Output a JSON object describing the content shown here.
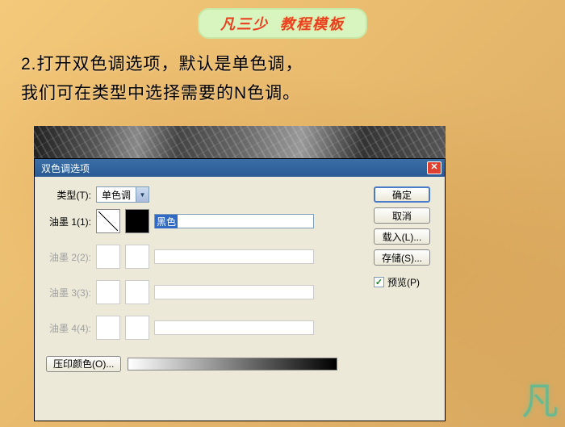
{
  "banner": {
    "part1": "凡三少",
    "part2": "教程模板"
  },
  "instruction": {
    "line1": "2.打开双色调选项，默认是单色调，",
    "line2": "我们可在类型中选择需要的N色调。"
  },
  "dialog": {
    "title": "双色调选项",
    "type_label": "类型(T):",
    "type_value": "单色调",
    "inks": [
      {
        "label": "油墨 1(1):",
        "name": "黑色",
        "enabled": true
      },
      {
        "label": "油墨 2(2):",
        "name": "",
        "enabled": false
      },
      {
        "label": "油墨 3(3):",
        "name": "",
        "enabled": false
      },
      {
        "label": "油墨 4(4):",
        "name": "",
        "enabled": false
      }
    ],
    "overprint_label": "压印颜色(O)...",
    "buttons": {
      "ok": "确定",
      "cancel": "取消",
      "load": "载入(L)...",
      "save": "存储(S)..."
    },
    "preview_label": "预览(P)",
    "preview_checked": true
  },
  "signature": "凡"
}
